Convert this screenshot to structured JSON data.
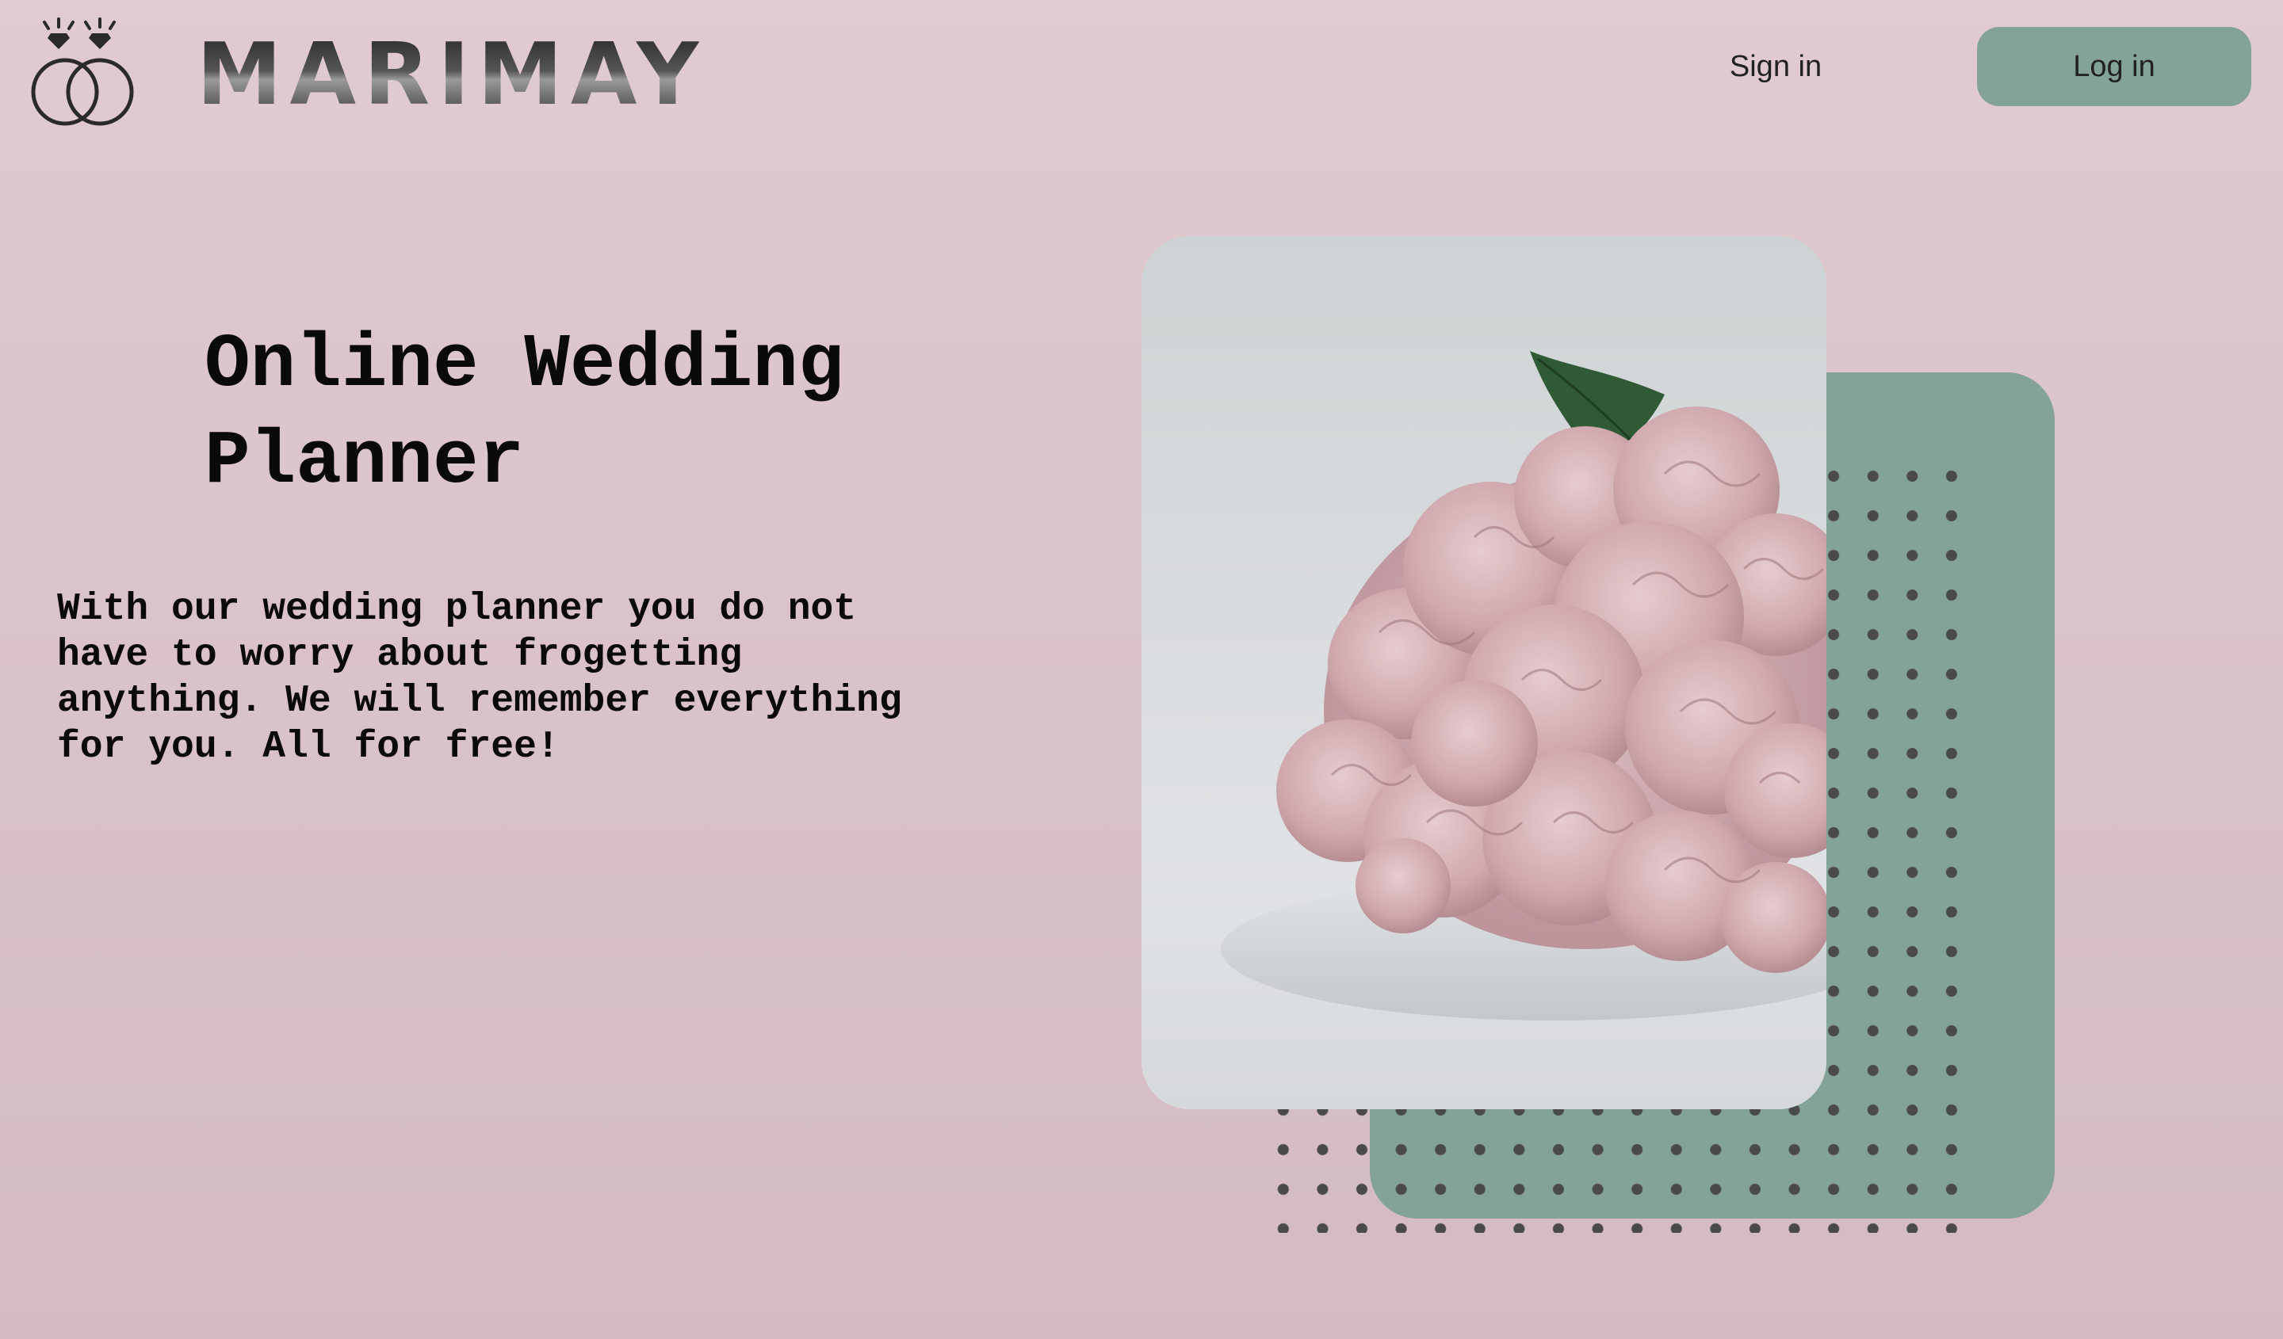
{
  "header": {
    "brand_name": "MARIMAY",
    "logo_icon": "wedding-rings-icon",
    "sign_in_label": "Sign in",
    "log_in_label": "Log in"
  },
  "hero": {
    "title": "Online Wedding Planner",
    "description": "With our wedding planner you do not have to worry about frogetting anything. We will remember everything for you. All for free!",
    "image_subject": "pink hydrangea bouquet"
  },
  "colors": {
    "background": "#dcc6cb",
    "accent_green": "#84a398",
    "text": "#0a0a0a",
    "dots": "#4a4a4a"
  }
}
